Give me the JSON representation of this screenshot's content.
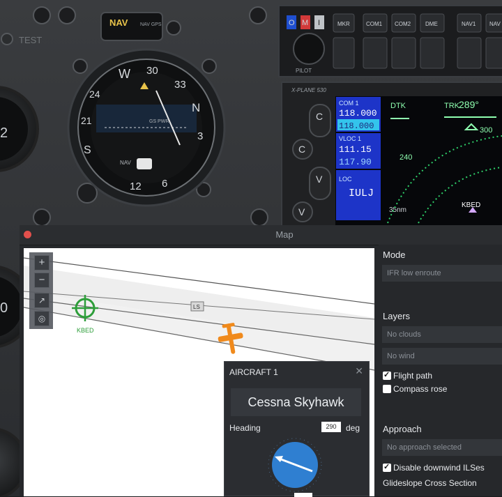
{
  "cockpit": {
    "test_label": "TEST",
    "nav_button": "NAV",
    "nav_gps_label": "NAV GPS",
    "audio_keys": [
      "O",
      "M",
      "I",
      "MKR",
      "COM1",
      "COM2",
      "DME",
      "NAV1",
      "NAV"
    ],
    "pilot_label": "PILOT",
    "gps_brand": "X-PLANE 530",
    "hsi_cardinals": [
      "W",
      "30",
      "33",
      "N",
      "3",
      "6",
      "12",
      "S",
      "21",
      "24"
    ],
    "hsi_gs_label": "GS PWR",
    "hsi_nav_label": "NAV",
    "hsi_dial_label": "⊙",
    "left_gauge_value": "0",
    "gps_screen": {
      "com_label": "COM 1",
      "com_active": "118.000",
      "com_standby": "118.000",
      "vloc_label": "VLOC 1",
      "vloc_active": "111.15",
      "vloc_standby": "117.90",
      "loc_label": "LOC",
      "loc_ident": "IULJ",
      "dtk_label": "DTK",
      "trk_label": "TRK",
      "trk_value": "289°",
      "range_300": "300",
      "range_240": "240",
      "scale": "35nm",
      "airport": "KBED"
    },
    "gps_buttons": [
      "C",
      "V",
      "C",
      "V"
    ]
  },
  "map_window": {
    "title": "Map",
    "zoom_buttons": [
      "+",
      "−"
    ],
    "tool_buttons": [
      "↗",
      "◎"
    ],
    "airport_label": "KBED",
    "fix_label": "LS",
    "right_panel": {
      "mode_heading": "Mode",
      "mode_value": "IFR low enroute",
      "layers_heading": "Layers",
      "clouds_value": "No clouds",
      "wind_value": "No wind",
      "flight_path_label": "Flight path",
      "flight_path_checked": true,
      "compass_rose_label": "Compass rose",
      "compass_rose_checked": false,
      "approach_heading": "Approach",
      "approach_value": "No approach selected",
      "disable_downwind_label": "Disable downwind ILSes",
      "disable_downwind_checked": true,
      "glideslope_heading": "Glideslope Cross Section"
    },
    "aircraft_popup": {
      "title": "AIRCRAFT 1",
      "close": "✕",
      "aircraft_name": "Cessna Skyhawk",
      "heading_label": "Heading",
      "heading_value": "290",
      "heading_unit": "deg"
    }
  },
  "colors": {
    "airport_green": "#2e9e3a",
    "aircraft_orange": "#f08a1c",
    "gps_blue": "#1f3fd8",
    "gps_cyan": "#38c8f0",
    "heading_dial_blue": "#2f7fd1"
  }
}
